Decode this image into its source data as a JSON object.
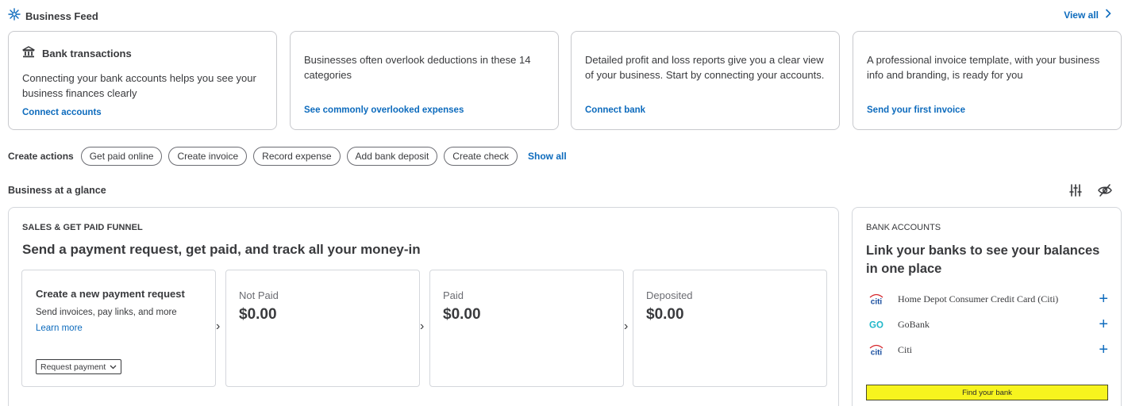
{
  "feed": {
    "title": "Business Feed",
    "view_all": "View all",
    "cards": [
      {
        "title": "Bank transactions",
        "text": "Connecting your bank accounts helps you see your business finances clearly",
        "link": "Connect accounts"
      },
      {
        "text": "Businesses often overlook deductions in these 14 categories",
        "link": "See commonly overlooked expenses"
      },
      {
        "text": "Detailed profit and loss reports give you a clear view of your business. Start by connecting your accounts.",
        "link": "Connect bank"
      },
      {
        "text": "A professional invoice template, with your business info and branding, is ready for you",
        "link": "Send your first invoice"
      }
    ]
  },
  "actions": {
    "label": "Create actions",
    "items": [
      "Get paid online",
      "Create invoice",
      "Record expense",
      "Add bank deposit",
      "Create check"
    ],
    "show_all": "Show all"
  },
  "glance": {
    "title": "Business at a glance"
  },
  "funnel": {
    "eyebrow": "SALES & GET PAID FUNNEL",
    "heading": "Send a payment request, get paid, and track all your money-in",
    "request": {
      "title": "Create a new payment request",
      "subtitle": "Send invoices, pay links, and more",
      "link": "Learn more",
      "button": "Request payment"
    },
    "stages": [
      {
        "label": "Not Paid",
        "amount": "$0.00"
      },
      {
        "label": "Paid",
        "amount": "$0.00"
      },
      {
        "label": "Deposited",
        "amount": "$0.00"
      }
    ]
  },
  "bank": {
    "eyebrow": "BANK ACCOUNTS",
    "heading": "Link your banks to see your balances in one place",
    "accounts": [
      {
        "name": "Home Depot Consumer Credit Card (Citi)",
        "logo": "citi",
        "logo_text": "citi"
      },
      {
        "name": "GoBank",
        "logo": "gobank",
        "logo_text": "GO"
      },
      {
        "name": "Citi",
        "logo": "citi",
        "logo_text": "citi"
      }
    ],
    "find_button": "Find your bank"
  },
  "colors": {
    "link": "#0d6bbd",
    "highlight": "#f7f41e",
    "gobank": "#1fb7c9",
    "citi_blue": "#1a4fa0",
    "citi_red": "#d6262b"
  }
}
